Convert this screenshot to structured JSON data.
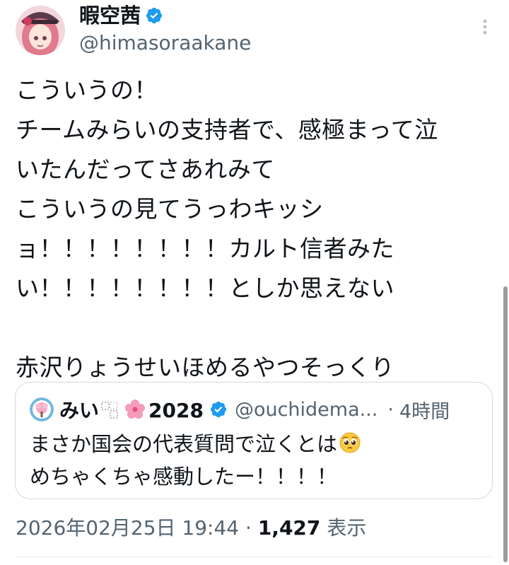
{
  "author": {
    "display_name": "暇空茜",
    "handle": "@himasoraakane",
    "verified_icon": "verified-badge-icon",
    "avatar_icon": "avatar-girl-pink-hair-icon"
  },
  "more_icon": "more-vertical-icon",
  "tweet": {
    "lines": [
      "こういうの！",
      "チームみらいの支持者で、感極まって泣",
      "いたんだってさあれみて",
      "こういうの見てうっわキッシ",
      "ョ！！！！！！！！カルト信者みた",
      "い！！！！！！！！としか思えない",
      "",
      "赤沢りょうせいほめるやつそっくり"
    ]
  },
  "quote": {
    "name_prefix": "みい",
    "name_suffix": "2028",
    "handle": "@ouchidema...",
    "separator": "·",
    "time": "4時間",
    "text_line1": "まさか国会の代表質問で泣くとは",
    "text_line2": "めちゃくちゃ感動したー！！！！",
    "icons": {
      "avatar": "sakura-circle-avatar-icon",
      "tofu": "missing-glyph-icon",
      "sakura": "cherry-blossom-icon",
      "verified": "verified-badge-icon",
      "emoji": "pleading-face-emoji-icon"
    }
  },
  "meta": {
    "date": "2026年02月25日 19:44",
    "separator": "·",
    "views_count": "1,427",
    "views_label": "表示"
  },
  "colors": {
    "text": "#0f1419",
    "secondary": "#536471",
    "verified": "#1d9bf0",
    "border": "#cfd9de"
  }
}
